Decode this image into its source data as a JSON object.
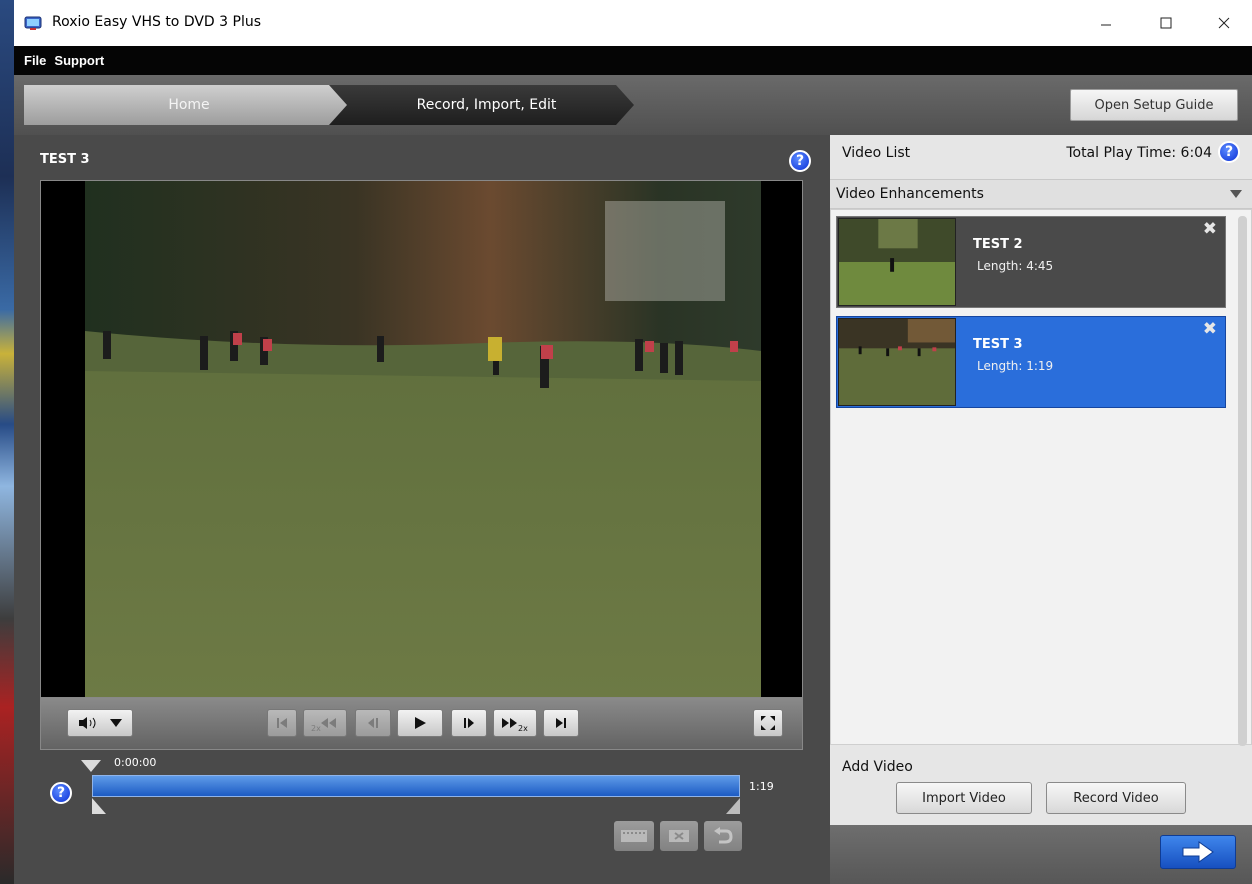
{
  "window": {
    "title": "Roxio Easy VHS to DVD 3 Plus"
  },
  "menu": {
    "items": [
      "File",
      "Support"
    ]
  },
  "nav": {
    "steps": [
      {
        "label": "Home"
      },
      {
        "label": "Record, Import, Edit"
      }
    ],
    "setup_guide_label": "Open Setup Guide"
  },
  "player": {
    "title": "TEST 3",
    "timeline": {
      "start_time": "0:00:00",
      "end_time": "1:19"
    }
  },
  "video_list": {
    "title": "Video List",
    "total_play_time": "Total Play Time: 6:04",
    "enhancements_label": "Video Enhancements",
    "clips": [
      {
        "name": "TEST 2",
        "length": "Length: 4:45",
        "selected": false
      },
      {
        "name": "TEST 3",
        "length": "Length: 1:19",
        "selected": true
      }
    ]
  },
  "add_video": {
    "label": "Add Video",
    "import_label": "Import Video",
    "record_label": "Record Video"
  },
  "icons": {
    "help": "help-icon",
    "close": "close-icon",
    "next": "arrow-right-icon",
    "volume": "speaker-icon",
    "fullscreen": "fullscreen-icon"
  },
  "colors": {
    "selection": "#2a6edb",
    "timeline": "#1c5bc4",
    "help": "#0b2fd6"
  }
}
